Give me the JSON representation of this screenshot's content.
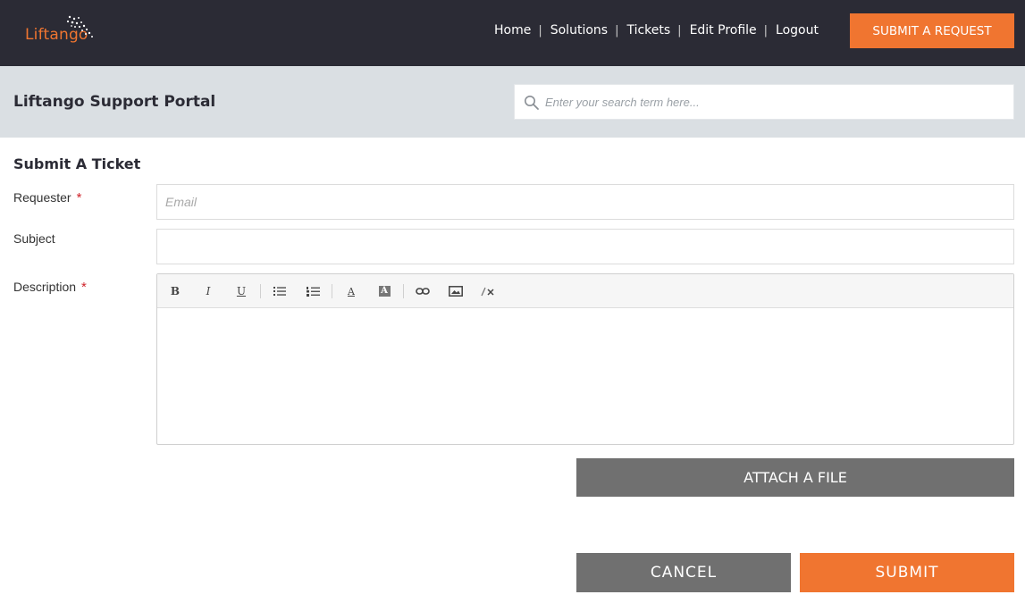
{
  "brand": {
    "name": "Liftango",
    "accent_color": "#f07530",
    "nav_bg": "#2b2b35"
  },
  "nav": {
    "items": [
      {
        "label": "Home"
      },
      {
        "label": "Solutions"
      },
      {
        "label": "Tickets"
      },
      {
        "label": "Edit Profile"
      },
      {
        "label": "Logout"
      }
    ],
    "separator": "|",
    "cta_label": "SUBMIT A REQUEST"
  },
  "portal": {
    "title": "Liftango Support Portal",
    "search_placeholder": "Enter your search term here...",
    "search_icon": "search-icon"
  },
  "form": {
    "heading": "Submit A Ticket",
    "required_marker": "*",
    "requester": {
      "label": "Requester",
      "placeholder": "Email",
      "value": ""
    },
    "subject": {
      "label": "Subject",
      "value": ""
    },
    "description": {
      "label": "Description",
      "value": "",
      "toolbar": [
        {
          "name": "bold-icon",
          "glyph": "B"
        },
        {
          "name": "italic-icon",
          "glyph": "I"
        },
        {
          "name": "underline-icon",
          "glyph": "U"
        },
        {
          "name": "bulleted-list-icon"
        },
        {
          "name": "numbered-list-icon"
        },
        {
          "name": "font-color-icon",
          "glyph": "A"
        },
        {
          "name": "background-color-icon",
          "glyph": "A"
        },
        {
          "name": "link-icon"
        },
        {
          "name": "image-icon"
        },
        {
          "name": "clear-formatting-icon"
        }
      ]
    },
    "attach_label": "ATTACH A FILE",
    "cancel_label": "CANCEL",
    "submit_label": "SUBMIT"
  }
}
